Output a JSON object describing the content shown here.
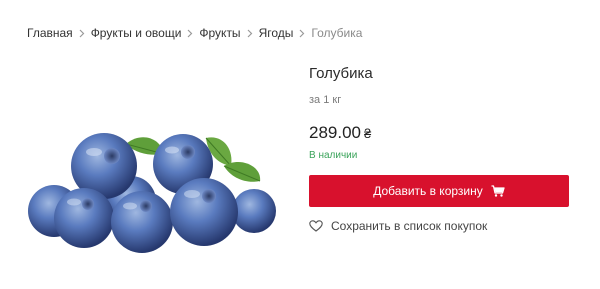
{
  "breadcrumb": {
    "items": [
      "Главная",
      "Фрукты и овощи",
      "Фрукты",
      "Ягоды"
    ],
    "current": "Голубика"
  },
  "product": {
    "title": "Голубика",
    "unit": "за 1 кг",
    "price": "289.00",
    "currency": "₴",
    "stock": "В наличии",
    "add_to_cart": "Добавить в корзину",
    "save_to_list": "Сохранить в список покупок",
    "image_icon": "blueberries-image"
  },
  "colors": {
    "accent": "#d8112d",
    "stock": "#3aa35a",
    "text": "#333333",
    "muted": "#8a8a8a"
  }
}
